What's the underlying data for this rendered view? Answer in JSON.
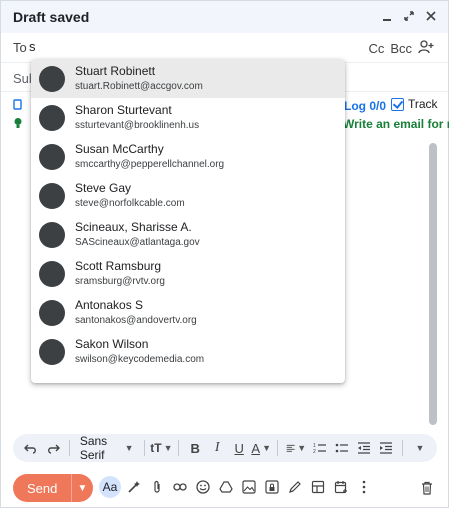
{
  "window": {
    "title": "Draft saved",
    "controls": [
      "minimize",
      "expand",
      "close"
    ]
  },
  "to": {
    "label": "To",
    "value": "s",
    "cc": "Cc",
    "bcc": "Bcc"
  },
  "subject": {
    "label": "Sub"
  },
  "assist": {
    "log_status": "Log 0/0",
    "track_label": "Track",
    "write_link": "Write an email for me"
  },
  "suggestions": [
    {
      "name": "Stuart Robinett",
      "email": "stuart.Robinett@accgov.com",
      "selected": true
    },
    {
      "name": "Sharon Sturtevant",
      "email": "ssturtevant@brooklinenh.us",
      "selected": false
    },
    {
      "name": "Susan McCarthy",
      "email": "smccarthy@pepperellchannel.org",
      "selected": false
    },
    {
      "name": "Steve Gay",
      "email": "steve@norfolkcable.com",
      "selected": false
    },
    {
      "name": "Scineaux, Sharisse A.",
      "email": "SAScineaux@atlantaga.gov",
      "selected": false
    },
    {
      "name": "Scott Ramsburg",
      "email": "sramsburg@rvtv.org",
      "selected": false
    },
    {
      "name": "Antonakos S",
      "email": "santonakos@andovertv.org",
      "selected": false
    },
    {
      "name": "Sakon Wilson",
      "email": "swilson@keycodemedia.com",
      "selected": false
    }
  ],
  "format": {
    "font": "Sans Serif",
    "size_icon": "tT",
    "bold": "B",
    "italic": "I",
    "underline": "U",
    "color": "A"
  },
  "bottom": {
    "send_label": "Send",
    "aa": "Aa"
  },
  "colors": {
    "send": "#f0785a",
    "accent": "#1a73e8",
    "green": "#188038"
  }
}
